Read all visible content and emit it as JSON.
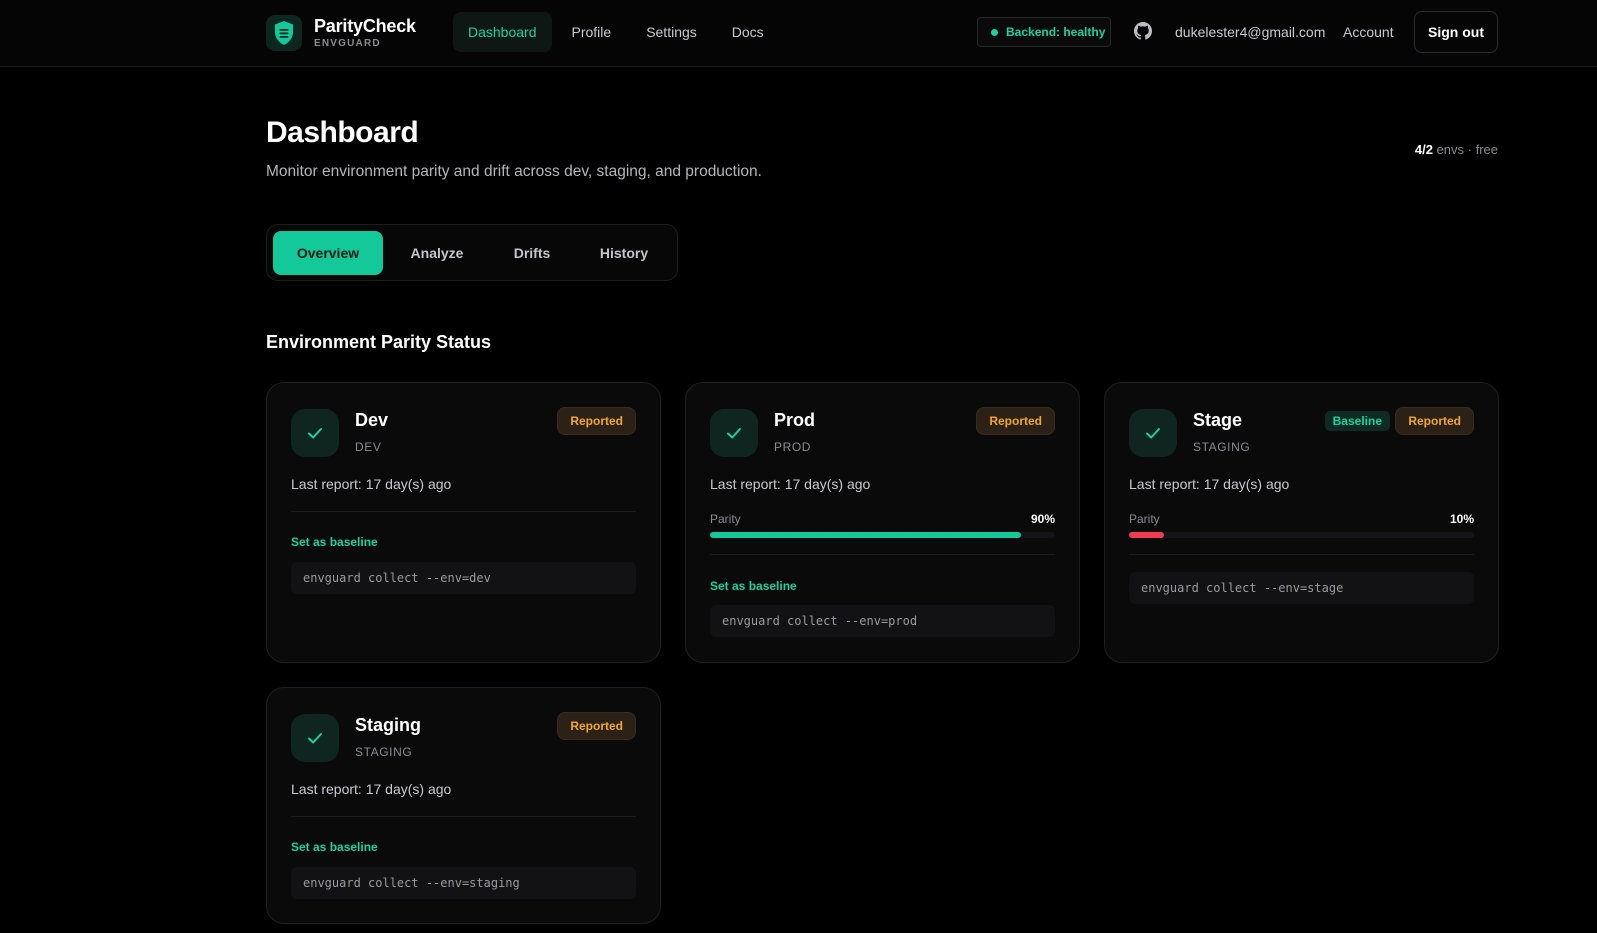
{
  "brand": {
    "name": "ParityCheck",
    "sub": "ENVGUARD"
  },
  "nav": {
    "items": [
      "Dashboard",
      "Profile",
      "Settings",
      "Docs"
    ],
    "active": "Dashboard"
  },
  "header_right": {
    "status": "Backend: healthy",
    "email": "dukelester4@gmail.com",
    "account": "Account",
    "signout": "Sign out"
  },
  "page": {
    "title": "Dashboard",
    "subtitle": "Monitor environment parity and drift across dev, staging, and production.",
    "usage_count": "4/2",
    "usage_rest": "envs · free"
  },
  "tabs": [
    "Overview",
    "Analyze",
    "Drifts",
    "History"
  ],
  "section_title": "Environment Parity Status",
  "cards": [
    {
      "name": "Dev",
      "key": "DEV",
      "badges": [
        "Reported"
      ],
      "last_report": "Last report: 17 day(s) ago",
      "parity": null,
      "set_baseline": "Set as baseline",
      "command": "envguard collect --env=dev"
    },
    {
      "name": "Prod",
      "key": "PROD",
      "badges": [
        "Reported"
      ],
      "last_report": "Last report: 17 day(s) ago",
      "parity": {
        "label": "Parity",
        "value": "90%",
        "fraction": 0.9,
        "color": "#13c99a"
      },
      "set_baseline": "Set as baseline",
      "command": "envguard collect --env=prod"
    },
    {
      "name": "Stage",
      "key": "STAGING",
      "badges": [
        "Baseline",
        "Reported"
      ],
      "last_report": "Last report: 17 day(s) ago",
      "parity": {
        "label": "Parity",
        "value": "10%",
        "fraction": 0.1,
        "color": "#f23a55"
      },
      "set_baseline": null,
      "command": "envguard collect --env=stage"
    },
    {
      "name": "Staging",
      "key": "STAGING",
      "badges": [
        "Reported"
      ],
      "last_report": "Last report: 17 day(s) ago",
      "parity": null,
      "set_baseline": "Set as baseline",
      "command": "envguard collect --env=staging"
    }
  ],
  "colors": {
    "accent": "#19d3a2",
    "warning": "#f0a733",
    "danger": "#f23a55"
  }
}
